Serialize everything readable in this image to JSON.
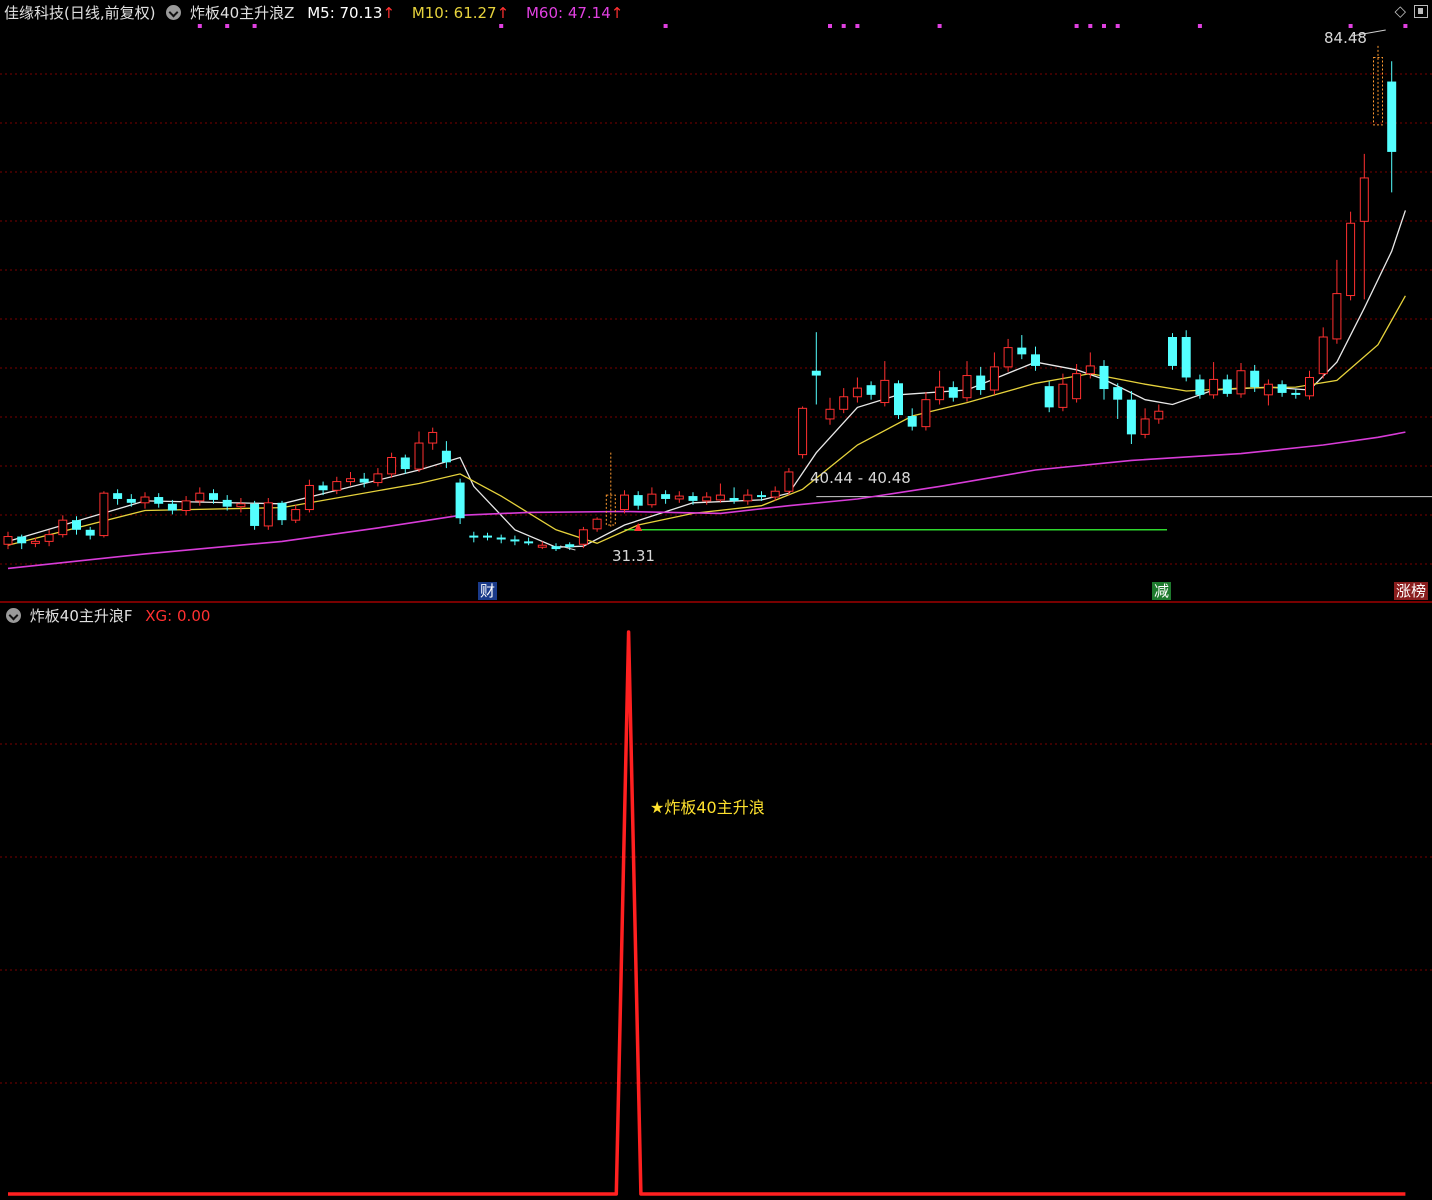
{
  "main": {
    "title": "佳缘科技(日线,前复权)",
    "indicator": "炸板40主升浪Z",
    "ma": [
      {
        "label": "M5: 70.13",
        "arrow": "↑",
        "color": "#ffffff"
      },
      {
        "label": "M10: 61.27",
        "arrow": "↑",
        "color": "#e6d23c"
      },
      {
        "label": "M60: 47.14",
        "arrow": "↑",
        "color": "#e040e0"
      }
    ],
    "annotations": {
      "high": "84.48",
      "low": "31.31",
      "range": "40.44 - 40.48"
    },
    "markers": [
      {
        "label": "财",
        "bg": "#1a3a8a",
        "color": "#ffffff"
      },
      {
        "label": "减",
        "bg": "#1e7a2e",
        "color": "#ffffff"
      },
      {
        "label": "涨榜",
        "bg": "#8a1e1e",
        "color": "#ffffff"
      }
    ]
  },
  "sub": {
    "indicator": "炸板40主升浪F",
    "xg_label": "XG: 0.00",
    "signal_label": "★炸板40主升浪"
  },
  "colors": {
    "up": "#ff3030",
    "down": "#54ffff",
    "ma5": "#e8e8e8",
    "ma10": "#e6d23c",
    "ma60": "#d83cd8",
    "grid": "#7a0000"
  },
  "chart_data": [
    {
      "type": "candlestick",
      "title": "佳缘科技(日线,前复权)",
      "ylim": [
        28,
        88
      ],
      "candles": [
        [
          35.5,
          36.3,
          35.0,
          36.8
        ],
        [
          36.3,
          35.6,
          35.0,
          36.5
        ],
        [
          35.6,
          35.8,
          35.2,
          36.2
        ],
        [
          35.8,
          36.5,
          35.3,
          37.0
        ],
        [
          36.5,
          38.0,
          36.2,
          38.5
        ],
        [
          38.0,
          37.0,
          36.5,
          38.4
        ],
        [
          37.0,
          36.4,
          36.0,
          37.3
        ],
        [
          36.4,
          40.8,
          36.2,
          41.0
        ],
        [
          40.8,
          40.2,
          39.6,
          41.2
        ],
        [
          40.2,
          39.8,
          39.4,
          40.7
        ],
        [
          39.8,
          40.4,
          39.2,
          40.9
        ],
        [
          40.4,
          39.7,
          39.3,
          40.8
        ],
        [
          39.7,
          39.0,
          38.6,
          40.1
        ],
        [
          39.0,
          40.0,
          38.5,
          40.5
        ],
        [
          40.0,
          40.8,
          39.5,
          41.4
        ],
        [
          40.8,
          40.1,
          39.7,
          41.2
        ],
        [
          40.1,
          39.4,
          39.0,
          40.6
        ],
        [
          39.4,
          39.7,
          38.8,
          40.3
        ],
        [
          39.7,
          37.4,
          37.0,
          40.0
        ],
        [
          37.4,
          39.8,
          37.0,
          40.3
        ],
        [
          39.8,
          38.0,
          37.5,
          40.0
        ],
        [
          38.0,
          39.1,
          37.7,
          39.6
        ],
        [
          39.1,
          41.6,
          38.8,
          42.2
        ],
        [
          41.6,
          41.1,
          40.6,
          42.0
        ],
        [
          41.1,
          42.0,
          40.7,
          42.5
        ],
        [
          42.0,
          42.3,
          41.6,
          43.0
        ],
        [
          42.3,
          41.9,
          41.4,
          42.9
        ],
        [
          41.9,
          42.8,
          41.5,
          43.4
        ],
        [
          42.8,
          44.5,
          42.4,
          45.0
        ],
        [
          44.5,
          43.3,
          42.8,
          44.8
        ],
        [
          43.3,
          46.0,
          43.0,
          47.2
        ],
        [
          46.0,
          47.1,
          45.3,
          47.6
        ],
        [
          45.2,
          44.0,
          43.4,
          46.2
        ],
        [
          41.9,
          38.2,
          37.6,
          42.3
        ],
        [
          36.4,
          36.2,
          35.7,
          36.8
        ],
        [
          36.4,
          36.3,
          35.9,
          36.7
        ],
        [
          36.2,
          36.0,
          35.6,
          36.5
        ],
        [
          36.0,
          35.9,
          35.4,
          36.4
        ],
        [
          35.8,
          35.7,
          35.4,
          36.2
        ],
        [
          35.2,
          35.4,
          35.0,
          35.8
        ],
        [
          35.3,
          35.0,
          34.8,
          35.6
        ],
        [
          35.5,
          35.2,
          34.9,
          35.7
        ],
        [
          35.5,
          37.0,
          35.1,
          37.3
        ],
        [
          37.1,
          38.1,
          36.8,
          38.3
        ],
        [
          37.5,
          40.6,
          37.2,
          45.0
        ],
        [
          39.1,
          40.6,
          38.7,
          41.1
        ],
        [
          40.6,
          39.5,
          39.1,
          41.0
        ],
        [
          39.6,
          40.7,
          39.3,
          41.4
        ],
        [
          40.7,
          40.2,
          39.7,
          41.1
        ],
        [
          40.2,
          40.5,
          39.8,
          41.0
        ],
        [
          40.5,
          40.0,
          39.6,
          40.9
        ],
        [
          40.0,
          40.4,
          39.6,
          40.9
        ],
        [
          40.1,
          40.6,
          39.8,
          41.8
        ],
        [
          40.3,
          40.0,
          39.7,
          41.4
        ],
        [
          40.0,
          40.6,
          39.6,
          41.2
        ],
        [
          40.6,
          40.4,
          40.0,
          41.0
        ],
        [
          40.4,
          41.0,
          40.0,
          41.5
        ],
        [
          41.0,
          43.0,
          40.6,
          43.4
        ],
        [
          44.8,
          49.6,
          44.4,
          49.8
        ],
        [
          53.5,
          53.0,
          50.0,
          57.5
        ],
        [
          48.5,
          49.5,
          47.9,
          50.7
        ],
        [
          49.5,
          50.8,
          49.1,
          51.7
        ],
        [
          50.8,
          51.7,
          50.2,
          52.8
        ],
        [
          52.0,
          51.0,
          50.5,
          52.4
        ],
        [
          50.2,
          52.5,
          49.8,
          54.5
        ],
        [
          52.2,
          48.9,
          48.5,
          52.5
        ],
        [
          48.8,
          47.7,
          47.3,
          49.6
        ],
        [
          47.7,
          50.5,
          47.3,
          51.3
        ],
        [
          50.5,
          51.8,
          50.0,
          53.5
        ],
        [
          51.8,
          50.7,
          50.3,
          52.4
        ],
        [
          50.7,
          53.0,
          50.3,
          54.5
        ],
        [
          53.0,
          51.5,
          51.0,
          53.9
        ],
        [
          51.5,
          53.9,
          51.0,
          55.4
        ],
        [
          53.9,
          55.9,
          53.4,
          56.8
        ],
        [
          55.9,
          55.2,
          54.7,
          57.2
        ],
        [
          55.2,
          54.0,
          53.5,
          56.0
        ],
        [
          51.9,
          49.7,
          49.2,
          52.4
        ],
        [
          49.7,
          52.1,
          49.3,
          53.2
        ],
        [
          50.6,
          53.2,
          50.2,
          54.2
        ],
        [
          53.2,
          54.0,
          52.7,
          55.4
        ],
        [
          54.0,
          51.6,
          50.5,
          54.6
        ],
        [
          51.8,
          50.5,
          48.5,
          52.2
        ],
        [
          50.5,
          46.9,
          45.9,
          51.4
        ],
        [
          46.9,
          48.5,
          46.5,
          49.6
        ],
        [
          48.5,
          49.3,
          48.0,
          50.0
        ],
        [
          57.0,
          54.0,
          53.6,
          57.4
        ],
        [
          57.0,
          52.8,
          52.4,
          57.7
        ],
        [
          52.6,
          51.0,
          50.6,
          53.1
        ],
        [
          51.0,
          52.6,
          50.6,
          54.4
        ],
        [
          52.6,
          51.1,
          50.8,
          53.1
        ],
        [
          51.1,
          53.5,
          50.7,
          54.3
        ],
        [
          53.5,
          51.8,
          51.3,
          54.1
        ],
        [
          51.0,
          52.1,
          49.9,
          52.6
        ],
        [
          52.1,
          51.2,
          50.8,
          52.5
        ],
        [
          51.2,
          51.0,
          50.6,
          51.6
        ],
        [
          50.9,
          52.8,
          50.5,
          53.5
        ],
        [
          53.2,
          57.0,
          52.7,
          58.0
        ],
        [
          56.8,
          61.5,
          56.3,
          65.0
        ],
        [
          61.3,
          68.8,
          60.8,
          70.0
        ],
        [
          69.0,
          73.5,
          60.9,
          76.0
        ],
        [
          79.0,
          86.0,
          80.0,
          87.2
        ],
        [
          83.5,
          76.2,
          72.0,
          85.6
        ]
      ],
      "series": [
        {
          "name": "M5",
          "color": "#e8e8e8",
          "values": [
            [
              0,
              35.8
            ],
            [
              10,
              40.0
            ],
            [
              20,
              39.7
            ],
            [
              30,
              43.2
            ],
            [
              33,
              44.5
            ],
            [
              34,
              41.5
            ],
            [
              37,
              37.0
            ],
            [
              40,
              35.2
            ],
            [
              42,
              35.3
            ],
            [
              45,
              37.5
            ],
            [
              50,
              39.8
            ],
            [
              55,
              40.1
            ],
            [
              57,
              40.8
            ],
            [
              59,
              45.0
            ],
            [
              62,
              49.7
            ],
            [
              65,
              51.0
            ],
            [
              70,
              51.5
            ],
            [
              75,
              54.4
            ],
            [
              78,
              53.6
            ],
            [
              80,
              52.6
            ],
            [
              83,
              50.5
            ],
            [
              85,
              50.0
            ],
            [
              88,
              51.5
            ],
            [
              92,
              51.8
            ],
            [
              95,
              51.5
            ],
            [
              97,
              54.4
            ],
            [
              99,
              60.0
            ],
            [
              101,
              65.9
            ],
            [
              102,
              70.13
            ]
          ]
        },
        {
          "name": "M10",
          "color": "#e6d23c",
          "values": [
            [
              0,
              35.4
            ],
            [
              10,
              39.0
            ],
            [
              20,
              39.3
            ],
            [
              30,
              41.8
            ],
            [
              33,
              42.8
            ],
            [
              36,
              40.5
            ],
            [
              40,
              37.0
            ],
            [
              43,
              35.6
            ],
            [
              46,
              37.5
            ],
            [
              50,
              38.7
            ],
            [
              55,
              39.5
            ],
            [
              58,
              41.2
            ],
            [
              62,
              45.8
            ],
            [
              66,
              48.8
            ],
            [
              70,
              50.2
            ],
            [
              75,
              52.2
            ],
            [
              79,
              53.2
            ],
            [
              83,
              52.1
            ],
            [
              86,
              51.4
            ],
            [
              90,
              51.7
            ],
            [
              94,
              51.8
            ],
            [
              97,
              52.5
            ],
            [
              100,
              56.2
            ],
            [
              102,
              61.27
            ]
          ]
        },
        {
          "name": "M60",
          "color": "#d83cd8",
          "values": [
            [
              0,
              33.0
            ],
            [
              10,
              34.5
            ],
            [
              20,
              35.8
            ],
            [
              27,
              37.2
            ],
            [
              33,
              38.5
            ],
            [
              38,
              38.8
            ],
            [
              45,
              38.9
            ],
            [
              52,
              38.7
            ],
            [
              57,
              39.5
            ],
            [
              62,
              40.2
            ],
            [
              68,
              41.5
            ],
            [
              75,
              43.2
            ],
            [
              82,
              44.2
            ],
            [
              90,
              44.9
            ],
            [
              96,
              45.8
            ],
            [
              100,
              46.6
            ],
            [
              102,
              47.14
            ]
          ]
        }
      ],
      "hlines": [
        {
          "y": 40.44
        },
        {
          "y": 37.0
        }
      ]
    },
    {
      "type": "line",
      "title": "炸板40主升浪F",
      "ylim": [
        0,
        1.1
      ],
      "series": [
        {
          "name": "XG",
          "values": [
            [
              0,
              0
            ],
            [
              44.4,
              0
            ],
            [
              45.3,
              1
            ],
            [
              46.2,
              0
            ],
            [
              102,
              0
            ]
          ]
        }
      ]
    }
  ]
}
